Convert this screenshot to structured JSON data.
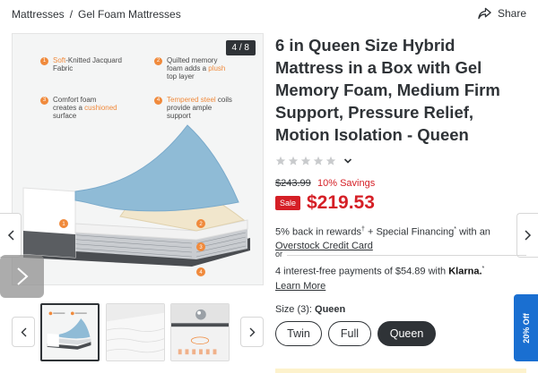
{
  "breadcrumb": {
    "items": [
      "Mattresses",
      "Gel Foam Mattresses"
    ],
    "separator": "/"
  },
  "share": {
    "label": "Share"
  },
  "gallery": {
    "counter": "4 / 8",
    "features": [
      {
        "num": "1",
        "pre": "",
        "highlight": "Soft",
        "post": "-Knitted Jacquard Fabric"
      },
      {
        "num": "2",
        "pre": "Quilted memory foam adds a ",
        "highlight": "plush",
        "post": " top layer"
      },
      {
        "num": "3",
        "pre": "Comfort foam creates a ",
        "highlight": "cushioned",
        "post": " surface"
      },
      {
        "num": "4",
        "pre": "",
        "highlight": "Tempered steel",
        "post": " coils provide ample support"
      }
    ],
    "layer_markers": [
      "1",
      "2",
      "3",
      "4"
    ]
  },
  "product": {
    "title": "6 in Queen Size Hybrid Mattress in a Box with Gel Memory Foam, Medium Firm Support, Pressure Relief, Motion Isolation - Queen",
    "rating_stars": 0,
    "old_price": "$243.99",
    "savings": "10% Savings",
    "sale_badge": "Sale",
    "price": "$219.53",
    "rewards_text": "5% back in rewards",
    "rewards_mark": "†",
    "financing_text": " + Special Financing",
    "financing_mark": "*",
    "financing_with": " with an",
    "credit_card_link": "Overstock Credit Card",
    "or": "or",
    "klarna_text": "4 interest-free payments of $54.89 with ",
    "klarna_brand": "Klarna.",
    "klarna_mark": "*",
    "learn_more": "Learn More",
    "size_label": "Size (3):",
    "size_selected": "Queen",
    "sizes": [
      "Twin",
      "Full",
      "Queen"
    ]
  },
  "promo_tab": {
    "label": "20% Off"
  },
  "colors": {
    "sale_red": "#d51f26",
    "accent_orange": "#f08a3c",
    "promo_blue": "#1a6fd1",
    "dark": "#2f3337"
  }
}
